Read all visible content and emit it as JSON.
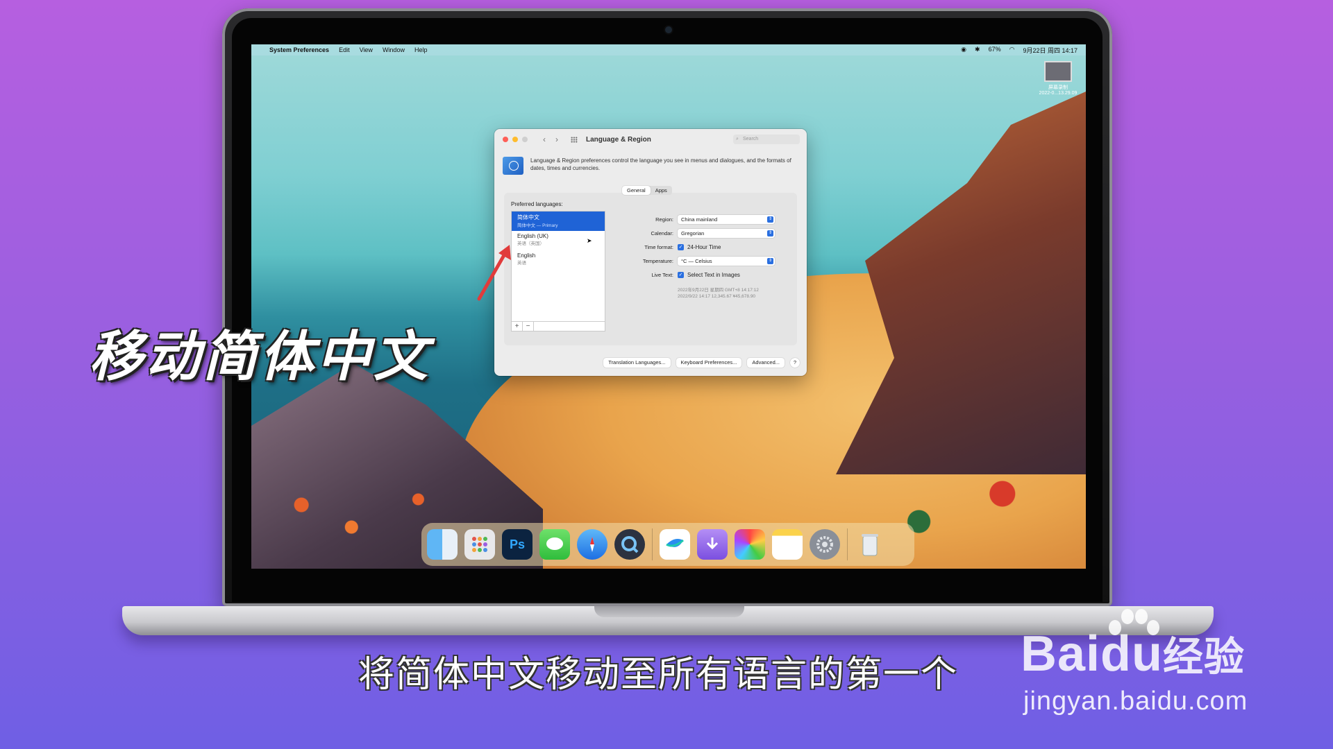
{
  "menubar": {
    "app": "System Preferences",
    "items": [
      "Edit",
      "View",
      "Window",
      "Help"
    ],
    "battery": "67%",
    "datetime": "9月22日 周四 14:17"
  },
  "screenshot_thumb": {
    "title": "屏幕录制",
    "date": "2022-0...13.29.09"
  },
  "window": {
    "title": "Language & Region",
    "search_placeholder": "Search",
    "description": "Language & Region preferences control the language you see in menus and dialogues, and the formats of dates, times and currencies.",
    "tabs": [
      "General",
      "Apps"
    ],
    "preferred_languages_label": "Preferred languages:",
    "languages": [
      {
        "name": "简体中文",
        "sub": "简体中文 — Primary",
        "selected": true
      },
      {
        "name": "English (UK)",
        "sub": "英语（英国）",
        "selected": false
      },
      {
        "name": "English",
        "sub": "英语",
        "selected": false
      }
    ],
    "add_label": "+",
    "remove_label": "−",
    "fields": {
      "region_label": "Region:",
      "region_value": "China mainland",
      "calendar_label": "Calendar:",
      "calendar_value": "Gregorian",
      "time_format_label": "Time format:",
      "time_format_value": "24-Hour Time",
      "temperature_label": "Temperature:",
      "temperature_value": "°C — Celsius",
      "live_text_label": "Live Text:",
      "live_text_value": "Select Text in Images"
    },
    "sample_line1": "2022年9月22日 星期四 GMT+8 14:17:12",
    "sample_line2": "2022/9/22 14:17     12,345.67     ¥45,678.90",
    "buttons": {
      "translation": "Translation Languages...",
      "keyboard": "Keyboard Preferences...",
      "advanced": "Advanced...",
      "help": "?"
    }
  },
  "dock": {
    "apps": [
      "finder-icon",
      "launchpad-icon",
      "photoshop-icon",
      "messages-icon",
      "safari-icon",
      "quicktime-icon",
      "lark-icon",
      "downloads-icon",
      "grapher-icon",
      "notes-icon",
      "system-preferences-icon",
      "trash-icon"
    ],
    "photoshop_label": "Ps"
  },
  "overlay": {
    "left_caption": "移动简体中文",
    "subtitle": "将简体中文移动至所有语言的第一个"
  },
  "watermark": {
    "logo_en": "Bai",
    "logo_du": "du",
    "logo_cn": "经验",
    "url": "jingyan.baidu.com"
  }
}
